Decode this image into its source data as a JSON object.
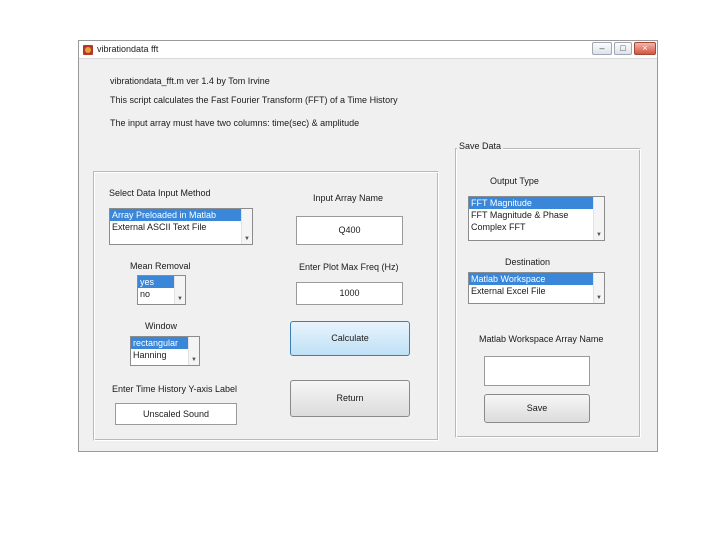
{
  "window": {
    "title": "vibrationdata fft",
    "controls": {
      "minimize": "–",
      "maximize": "□",
      "close": "×"
    }
  },
  "intro": {
    "line1": "vibrationdata_fft.m ver 1.4 by Tom Irvine",
    "line2": "This script calculates the Fast Fourier Transform (FFT) of a Time History",
    "line3": "The input array must have two columns: time(sec) & amplitude"
  },
  "input_method": {
    "label": "Select Data Input Method",
    "options": [
      "Array Preloaded in Matlab",
      "External ASCII Text File"
    ],
    "selected": 0
  },
  "input_array": {
    "label": "Input Array Name",
    "value": "Q400"
  },
  "mean_removal": {
    "label": "Mean Removal",
    "options": [
      "yes",
      "no"
    ],
    "selected": 0
  },
  "plot_max_freq": {
    "label": "Enter Plot Max Freq (Hz)",
    "value": "1000"
  },
  "window_type": {
    "label": "Window",
    "options": [
      "rectangular",
      "Hanning"
    ],
    "selected": 0
  },
  "calculate_label": "Calculate",
  "y_label": {
    "label": "Enter Time History Y-axis Label",
    "value": "Unscaled Sound"
  },
  "return_label": "Return",
  "save_data": {
    "title": "Save Data",
    "output_type": {
      "label": "Output Type",
      "options": [
        "FFT Magnitude",
        "FFT Magnitude & Phase",
        "Complex FFT"
      ],
      "selected": 0
    },
    "destination": {
      "label": "Destination",
      "options": [
        "Matlab Workspace",
        "External Excel File"
      ],
      "selected": 0
    },
    "workspace_array": {
      "label": "Matlab Workspace Array Name",
      "value": ""
    },
    "save_label": "Save"
  }
}
